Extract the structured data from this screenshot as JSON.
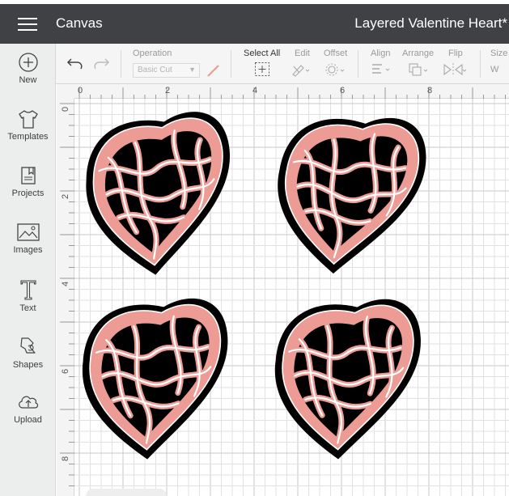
{
  "header": {
    "app_title": "Canvas",
    "project_title": "Layered Valentine Heart*"
  },
  "sidebar": {
    "items": [
      {
        "label": "New",
        "icon": "plus-circle-icon"
      },
      {
        "label": "Templates",
        "icon": "tshirt-icon"
      },
      {
        "label": "Projects",
        "icon": "bookmark-icon"
      },
      {
        "label": "Images",
        "icon": "image-icon"
      },
      {
        "label": "Text",
        "icon": "text-t-icon"
      },
      {
        "label": "Shapes",
        "icon": "shapes-icon"
      },
      {
        "label": "Upload",
        "icon": "cloud-upload-icon"
      }
    ]
  },
  "toolbar": {
    "operation_label": "Operation",
    "operation_value": "Basic Cut",
    "select_all_label": "Select All",
    "edit_label": "Edit",
    "offset_label": "Offset",
    "align_label": "Align",
    "arrange_label": "Arrange",
    "flip_label": "Flip",
    "size_label": "Size",
    "size_w": "W"
  },
  "ruler": {
    "top_numbers": [
      "0",
      "2",
      "4",
      "6",
      "8"
    ],
    "left_numbers": [
      "0",
      "2",
      "4",
      "6",
      "8"
    ]
  },
  "colors": {
    "header_bg": "#3f4145",
    "heart_pink": "#ec9c95",
    "heart_black": "#000000",
    "heart_white": "#ffffff"
  },
  "canvas": {
    "heart_count": 4
  }
}
